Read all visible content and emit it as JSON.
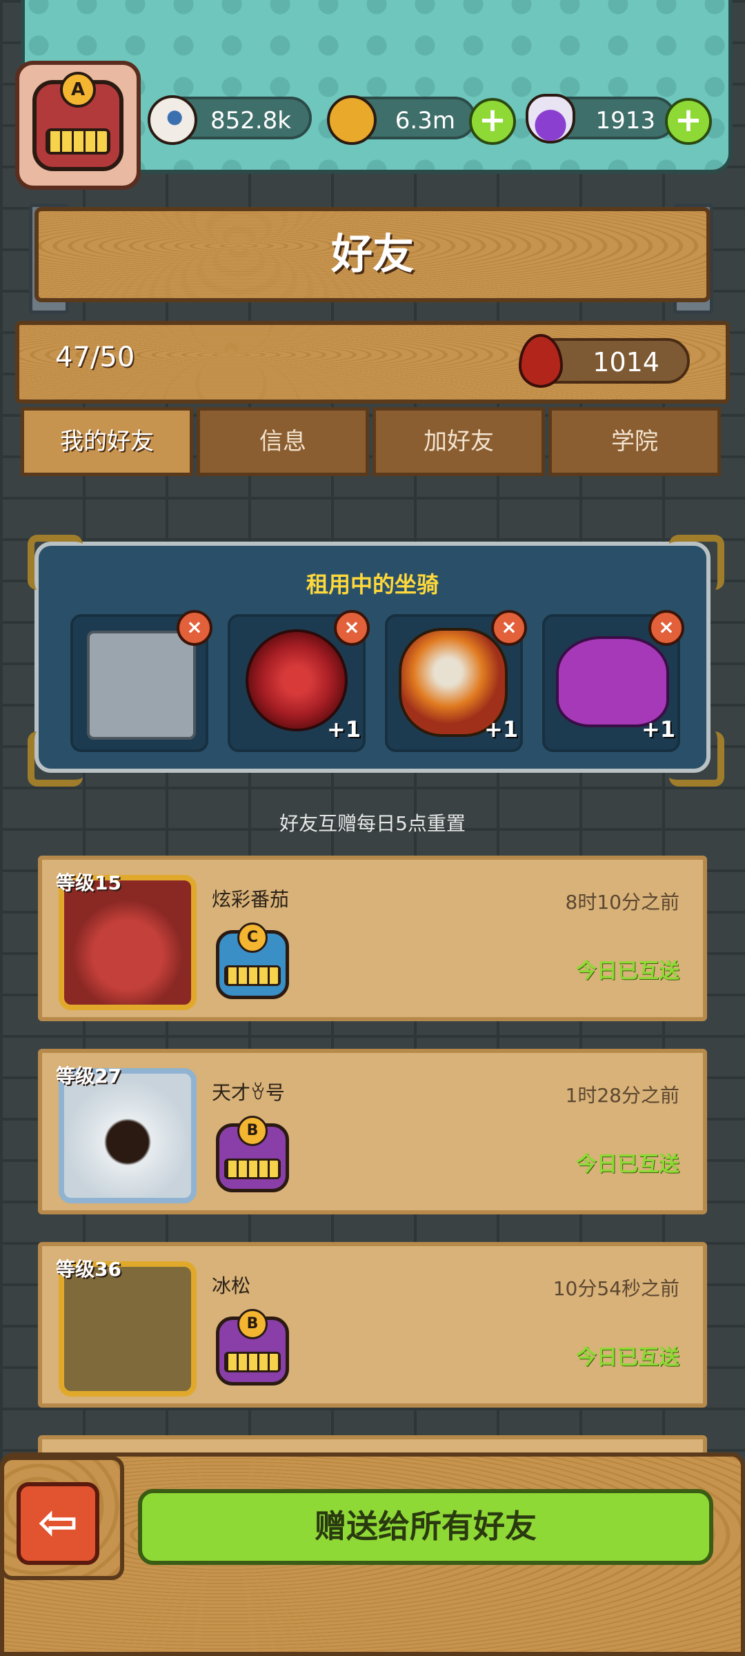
{
  "header": {
    "avatar_grade": "A",
    "resources": [
      {
        "icon": "eyeball-icon",
        "value": "852.8k"
      },
      {
        "icon": "coin-icon",
        "value": "6.3m"
      },
      {
        "icon": "potion-icon",
        "value": "1913"
      }
    ],
    "plus_glyph": "+"
  },
  "title": "好友",
  "stats": {
    "friend_count": "47/50",
    "blood_value": "1014"
  },
  "tabs": [
    {
      "label": "我的好友",
      "active": true
    },
    {
      "label": "信息",
      "active": false
    },
    {
      "label": "加好友",
      "active": false
    },
    {
      "label": "学院",
      "active": false
    }
  ],
  "mounts": {
    "title": "租用中的坐骑",
    "items": [
      {
        "icon": "machine-mount-icon",
        "bonus": ""
      },
      {
        "icon": "rose-mount-icon",
        "bonus": "+1"
      },
      {
        "icon": "lion-dance-mount-icon",
        "bonus": "+1"
      },
      {
        "icon": "purple-demon-mount-icon",
        "bonus": "+1"
      }
    ],
    "close_glyph": "×"
  },
  "reset_note": "好友互赠每日5点重置",
  "friends": [
    {
      "level": "等级15",
      "name": "炫彩番茄",
      "time": "8时10分之前",
      "status": "今日已互送",
      "grade": "C",
      "badge_color": "#3a8fc7"
    },
    {
      "level": "等级27",
      "name": "天才ꈊ号",
      "time": "1时28分之前",
      "status": "今日已互送",
      "grade": "B",
      "badge_color": "#8a3fa8"
    },
    {
      "level": "等级36",
      "name": "冰松",
      "time": "10分54秒之前",
      "status": "今日已互送",
      "grade": "B",
      "badge_color": "#8a3fa8"
    }
  ],
  "bottom": {
    "back_glyph": "⇦",
    "send_all_label": "赠送给所有好友"
  }
}
